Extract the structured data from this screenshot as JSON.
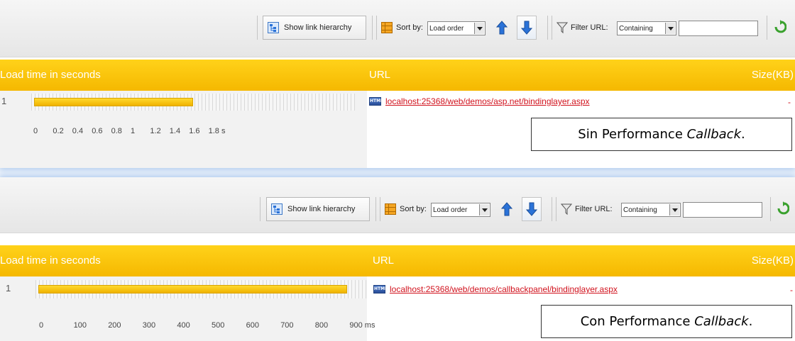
{
  "panels": [
    {
      "toolbar": {
        "show_link_hierarchy": "Show link hierarchy",
        "sort_by_label": "Sort by:",
        "sort_value": "Load order",
        "filter_label": "Filter URL:",
        "filter_mode": "Containing",
        "filter_text": ""
      },
      "header": {
        "load_time": "Load time in seconds",
        "url": "URL",
        "size": "Size(KB)"
      },
      "row": {
        "number": "1",
        "url": "localhost:25368/web/demos/asp.net/bindinglayer.aspx",
        "size": "-",
        "load_fraction": 0.5
      },
      "axis_ticks": [
        "0",
        "0.2",
        "0.4",
        "0.6",
        "0.8",
        "1",
        "1.2",
        "1.4",
        "1.6",
        "1.8 s"
      ],
      "caption": {
        "prefix": "Sin Performance ",
        "emph": "Callback",
        "suffix": "."
      }
    },
    {
      "toolbar": {
        "show_link_hierarchy": "Show link hierarchy",
        "sort_by_label": "Sort by:",
        "sort_value": "Load order",
        "filter_label": "Filter URL:",
        "filter_mode": "Containing",
        "filter_text": ""
      },
      "header": {
        "load_time": "Load time in seconds",
        "url": "URL",
        "size": "Size(KB)"
      },
      "row": {
        "number": "1",
        "url": "localhost:25368/web/demos/callbackpanel/bindinglayer.aspx",
        "size": "-",
        "load_fraction": 0.95
      },
      "axis_ticks": [
        "0",
        "100",
        "200",
        "300",
        "400",
        "500",
        "600",
        "700",
        "800",
        "900 ms"
      ],
      "caption": {
        "prefix": "Con Performance ",
        "emph": "Callback",
        "suffix": "."
      }
    }
  ],
  "icons": {
    "hierarchy": "hierarchy-icon",
    "grid": "grid-icon",
    "sort_up": "arrow-up-icon",
    "sort_down": "arrow-down-icon",
    "filter": "funnel-icon",
    "refresh": "refresh-icon",
    "html_file": "html-file-icon"
  },
  "colors": {
    "header": "#f5b800",
    "link": "#d1121d",
    "bar": "#f0b200",
    "arrow": "#2a72d8"
  }
}
